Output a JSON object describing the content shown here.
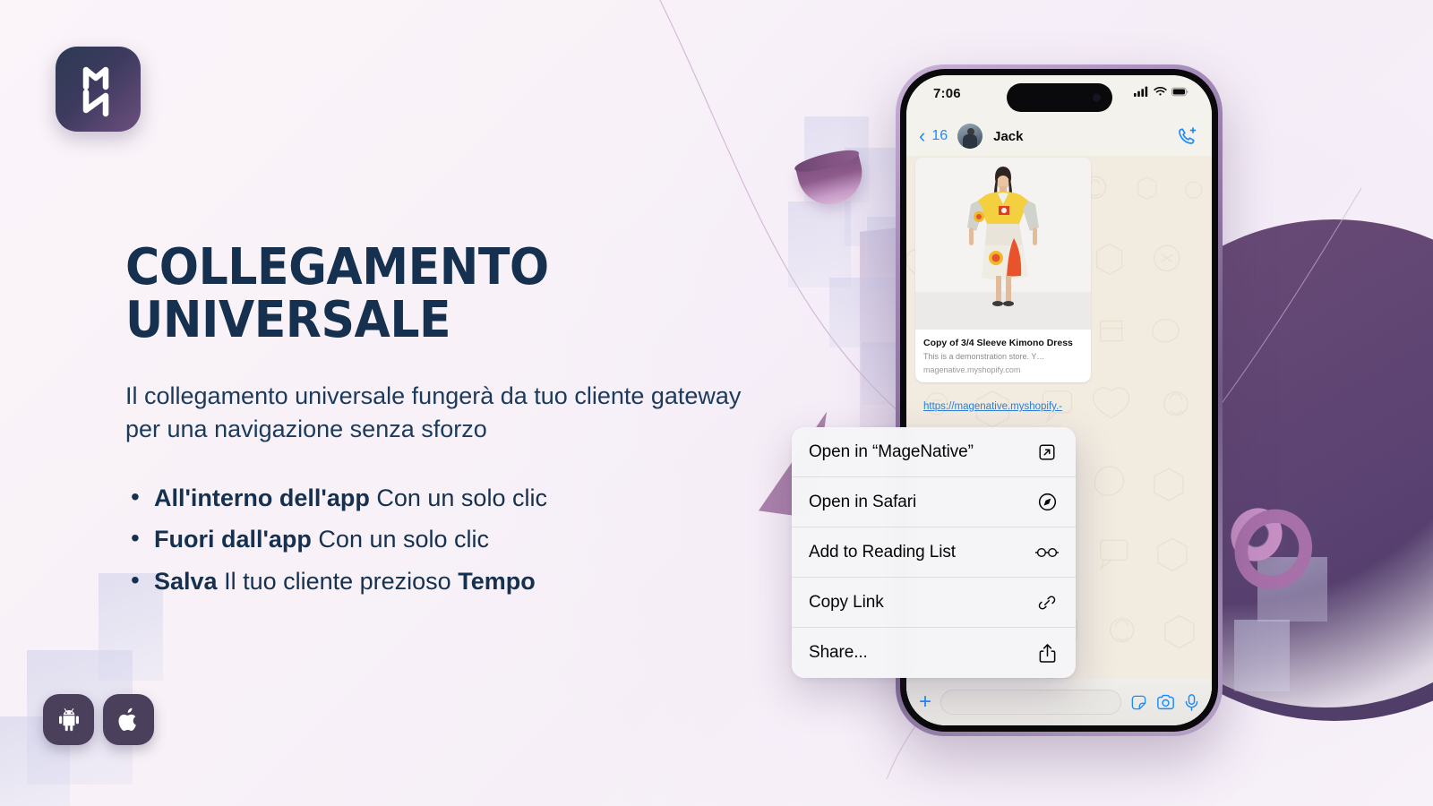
{
  "brand": {
    "logo_alt": "MageNative logo monogram MN"
  },
  "hero": {
    "headline": "COLLEGAMENTO UNIVERSALE",
    "subhead": "Il collegamento universale fungerà da tuo cliente gateway per una navigazione senza sforzo",
    "bullets": [
      {
        "strong": "All'interno dell'app",
        "rest": " Con un solo clic",
        "strong_tail": ""
      },
      {
        "strong": "Fuori dall'app",
        "rest": " Con un solo clic",
        "strong_tail": ""
      },
      {
        "strong": "Salva",
        "rest": " Il tuo cliente prezioso ",
        "strong_tail": "Tempo"
      }
    ]
  },
  "store_badges": [
    {
      "name": "android-badge",
      "icon": "android-icon"
    },
    {
      "name": "apple-badge",
      "icon": "apple-icon"
    }
  ],
  "phone": {
    "status_bar": {
      "time": "7:06",
      "signal": "signal-icon",
      "wifi": "wifi-icon",
      "battery": "battery-icon"
    },
    "chat_header": {
      "back_count": "16",
      "contact_name": "Jack",
      "call_icon": "phone-plus-icon"
    },
    "message": {
      "product_title": "Copy of 3/4 Sleeve Kimono Dress",
      "product_desc": "This is a demonstration store. Y…",
      "product_host": "magenative.myshopify.com",
      "link_text": "https://magenative.myshopify.-"
    },
    "input_bar": {
      "plus": "plus-icon",
      "placeholder": "",
      "sticker": "sticker-icon",
      "camera": "camera-icon",
      "mic": "microphone-icon"
    }
  },
  "context_menu": {
    "items": [
      {
        "label": "Open in “MageNative”",
        "icon": "open-external-icon"
      },
      {
        "label": "Open in Safari",
        "icon": "safari-compass-icon"
      },
      {
        "label": "Add to Reading List",
        "icon": "reading-glasses-icon"
      },
      {
        "label": "Copy Link",
        "icon": "link-chain-icon"
      },
      {
        "label": "Share...",
        "icon": "share-upload-icon"
      }
    ]
  },
  "colors": {
    "navy": "#15314f",
    "accent_blue": "#1a8cff",
    "purple_dark": "#5a4272",
    "purple_mid": "#9d6f9c",
    "badge_bg": "#4b405c",
    "page_bg": "#f8f2f8"
  }
}
